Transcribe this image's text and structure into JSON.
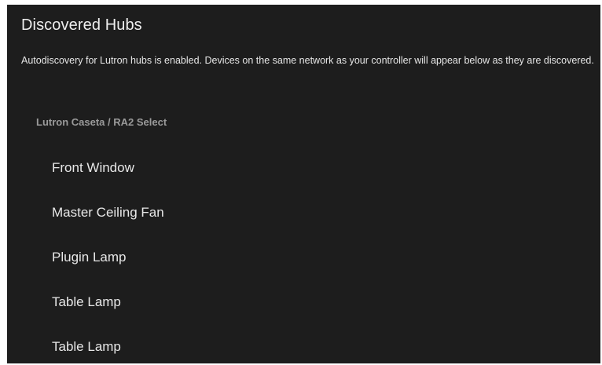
{
  "header": {
    "title": "Discovered Hubs"
  },
  "description": "Autodiscovery for Lutron hubs is enabled. Devices on the same network as your controller will appear below as they are discovered.",
  "section": {
    "label": "Lutron Caseta / RA2 Select",
    "devices": [
      {
        "label": "Front Window"
      },
      {
        "label": "Master Ceiling Fan"
      },
      {
        "label": "Plugin Lamp"
      },
      {
        "label": "Table Lamp"
      },
      {
        "label": "Table Lamp"
      }
    ]
  },
  "colors": {
    "panel_background": "#1d1d1d",
    "primary_text": "#eeeeee",
    "section_header_text": "#9a9a9a"
  }
}
